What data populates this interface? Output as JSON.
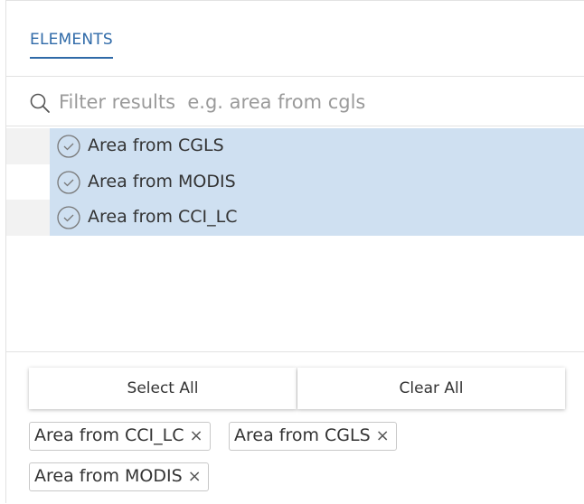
{
  "tabs": [
    {
      "label": "ELEMENTS",
      "active": true
    }
  ],
  "search": {
    "placeholder": "Filter results  e.g. area from cgls",
    "value": ""
  },
  "items": [
    {
      "label": "Area from CGLS",
      "selected": true
    },
    {
      "label": "Area from MODIS",
      "selected": true
    },
    {
      "label": "Area from CCI_LC",
      "selected": true
    }
  ],
  "actions": {
    "select_all": "Select All",
    "clear_all": "Clear All"
  },
  "chips": [
    {
      "label": "Area from CCI_LC",
      "remove": "×"
    },
    {
      "label": "Area from CGLS",
      "remove": "×"
    },
    {
      "label": "Area from MODIS",
      "remove": "×"
    }
  ],
  "colors": {
    "accent": "#2f6aa8",
    "selected_row": "#cfe0f1"
  }
}
